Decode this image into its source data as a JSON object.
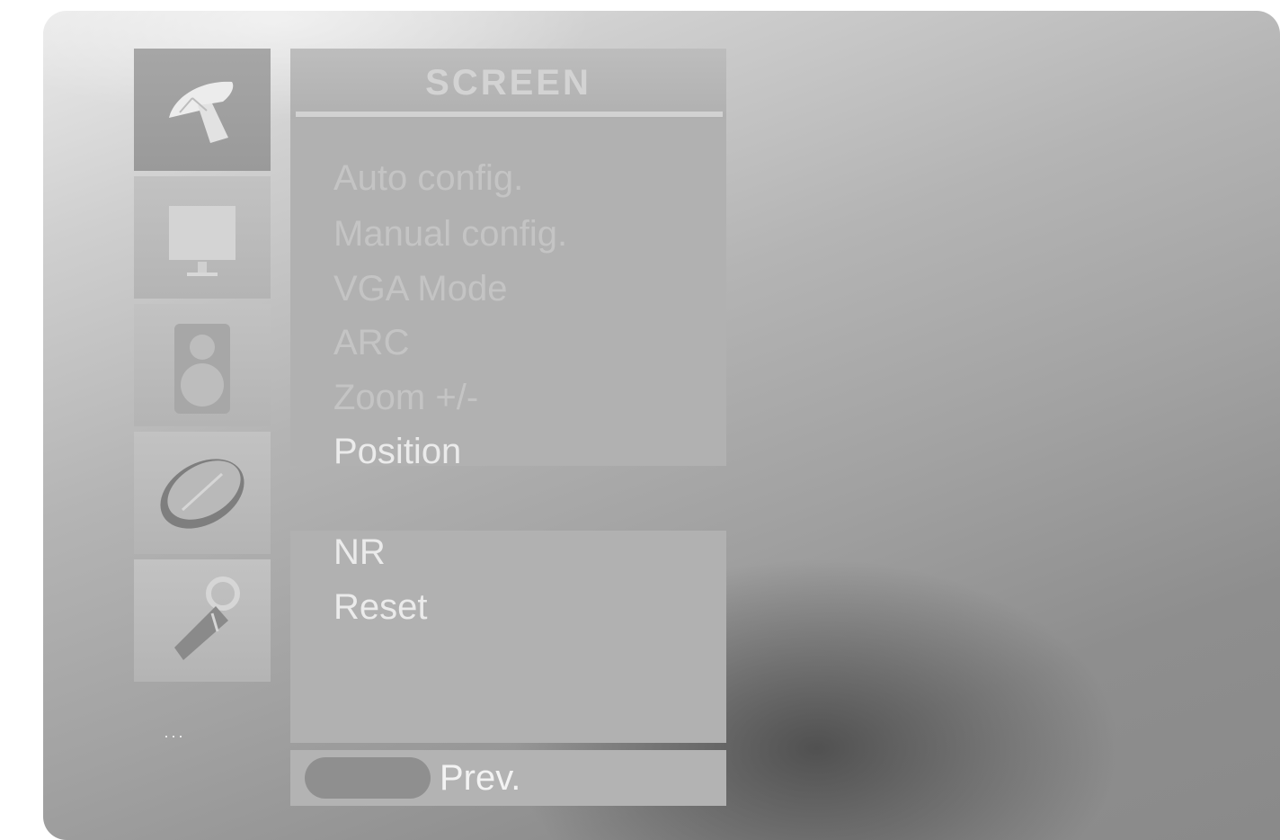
{
  "menu": {
    "title": "SCREEN",
    "items": [
      {
        "label": "Auto config."
      },
      {
        "label": "Manual config."
      },
      {
        "label": "VGA Mode"
      },
      {
        "label": "ARC"
      },
      {
        "label": "Zoom +/-"
      },
      {
        "label": "Position"
      }
    ],
    "items2": [
      {
        "label": "NR"
      },
      {
        "label": "Reset"
      }
    ]
  },
  "footer": {
    "prev_label": "Prev."
  },
  "icons": [
    "satellite-dish-icon",
    "picture-icon",
    "speaker-icon",
    "clock-icon",
    "key-icon"
  ],
  "colors": {
    "panel": "#b1b1b1",
    "text": "#ebebeb",
    "faded_text": "#c4c4c4",
    "pill": "#8f8f8f"
  }
}
